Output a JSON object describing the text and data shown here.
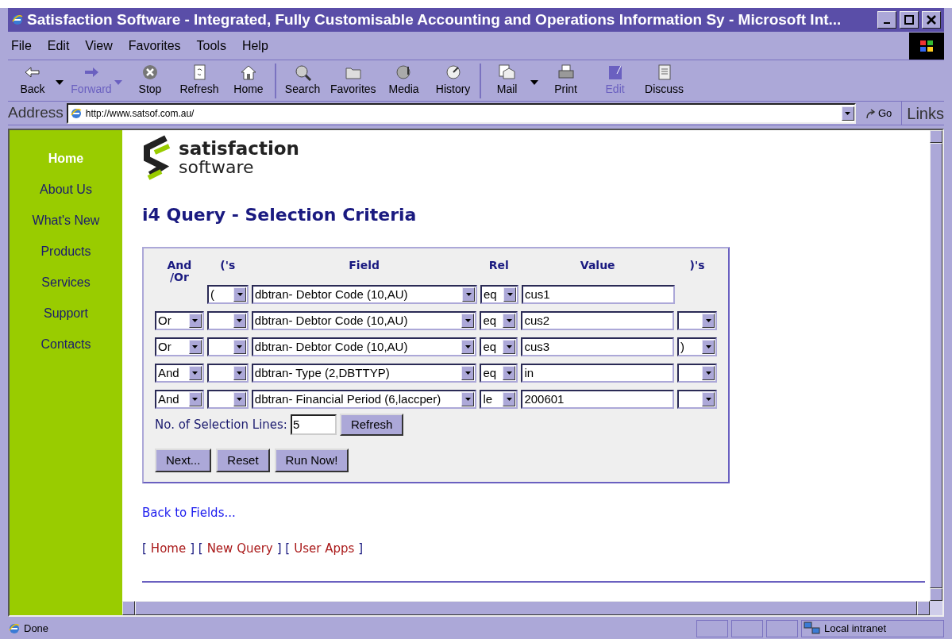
{
  "window": {
    "title": "Satisfaction Software - Integrated, Fully Customisable Accounting and Operations Information Sy - Microsoft Int..."
  },
  "menu": [
    "File",
    "Edit",
    "View",
    "Favorites",
    "Tools",
    "Help"
  ],
  "toolbar": [
    {
      "label": "Back",
      "disabled": false,
      "dropdown": true
    },
    {
      "label": "Forward",
      "disabled": true,
      "dropdown": true
    },
    {
      "label": "Stop",
      "disabled": false,
      "dropdown": false
    },
    {
      "label": "Refresh",
      "disabled": false,
      "dropdown": false
    },
    {
      "label": "Home",
      "disabled": false,
      "dropdown": false
    },
    {
      "label": "Search",
      "disabled": false,
      "dropdown": false,
      "separator": true
    },
    {
      "label": "Favorites",
      "disabled": false,
      "dropdown": false
    },
    {
      "label": "Media",
      "disabled": false,
      "dropdown": false
    },
    {
      "label": "History",
      "disabled": false,
      "dropdown": false
    },
    {
      "label": "Mail",
      "disabled": false,
      "dropdown": true,
      "separator": true
    },
    {
      "label": "Print",
      "disabled": false,
      "dropdown": false
    },
    {
      "label": "Edit",
      "disabled": true,
      "dropdown": false
    },
    {
      "label": "Discuss",
      "disabled": false,
      "dropdown": false
    }
  ],
  "address": {
    "label": "Address",
    "url": "http://www.satsof.com.au/",
    "go": "Go",
    "links": "Links"
  },
  "sidebar": {
    "items": [
      {
        "label": "Home",
        "selected": true
      },
      {
        "label": "About Us",
        "selected": false
      },
      {
        "label": "What's New",
        "selected": false
      },
      {
        "label": "Products",
        "selected": false
      },
      {
        "label": "Services",
        "selected": false
      },
      {
        "label": "Support",
        "selected": false
      },
      {
        "label": "Contacts",
        "selected": false
      }
    ]
  },
  "logo": {
    "line1": "satisfaction",
    "line2": "software"
  },
  "heading": "i4 Query - Selection Criteria",
  "criteria": {
    "columns": [
      {
        "label": "And\n/Or"
      },
      {
        "label": "('s"
      },
      {
        "label": "Field"
      },
      {
        "label": "Rel"
      },
      {
        "label": "Value"
      },
      {
        "label": ")'s"
      }
    ],
    "rows": [
      {
        "and_or": null,
        "open": "(",
        "field": "dbtran- Debtor Code (10,AU)",
        "rel": "eq",
        "value": "cus1",
        "close": null
      },
      {
        "and_or": "Or",
        "open": "",
        "field": "dbtran- Debtor Code (10,AU)",
        "rel": "eq",
        "value": "cus2",
        "close": ""
      },
      {
        "and_or": "Or",
        "open": "",
        "field": "dbtran- Debtor Code (10,AU)",
        "rel": "eq",
        "value": "cus3",
        "close": ")"
      },
      {
        "and_or": "And",
        "open": "",
        "field": "dbtran- Type (2,DBTTYP)",
        "rel": "eq",
        "value": "in",
        "close": ""
      },
      {
        "and_or": "And",
        "open": "",
        "field": "dbtran- Financial Period (6,laccper)",
        "rel": "le",
        "value": "200601",
        "close": ""
      }
    ],
    "lines_label": "No. of Selection Lines:",
    "lines": "5",
    "refresh": "Refresh",
    "buttons": [
      "Next...",
      "Reset",
      "Run Now!"
    ]
  },
  "back_link": "Back to Fields...",
  "footer": [
    {
      "kind": "bracket",
      "text": "["
    },
    {
      "kind": "link",
      "text": "Home"
    },
    {
      "kind": "bracket",
      "text": "] ["
    },
    {
      "kind": "link",
      "text": "New Query"
    },
    {
      "kind": "bracket",
      "text": "] ["
    },
    {
      "kind": "link",
      "text": "User Apps"
    },
    {
      "kind": "bracket",
      "text": "]"
    }
  ],
  "status_bar": {
    "text": "Done",
    "zone": "Local intranet"
  }
}
